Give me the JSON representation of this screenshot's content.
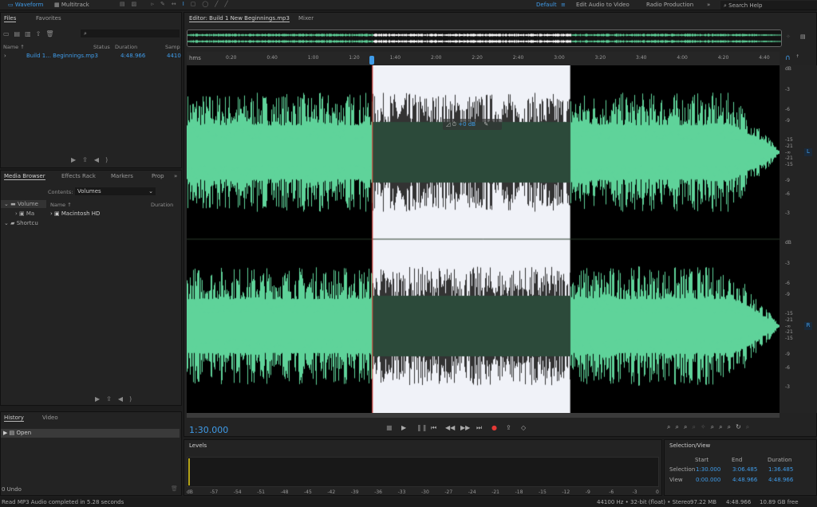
{
  "topbar": {
    "modes": [
      "Waveform",
      "Multitrack"
    ],
    "workspaces": [
      "Default",
      "Edit Audio to Video",
      "Radio Production"
    ],
    "more": "»",
    "search_placeholder": "Search Help"
  },
  "files": {
    "tabs": [
      "Files",
      "Favorites"
    ],
    "columns": [
      "Name ↑",
      "Status",
      "Duration",
      "Samp"
    ],
    "rows": [
      {
        "name": "Build 1... Beginnings.mp3",
        "duration": "4:48.966",
        "sample": "4410"
      }
    ]
  },
  "media_browser": {
    "tabs": [
      "Media Browser",
      "Effects Rack",
      "Markers",
      "Prop"
    ],
    "contents_label": "Contents:",
    "contents_value": "Volumes",
    "tree": [
      "Volume",
      "Ma",
      "Shortcu"
    ],
    "columns": [
      "Name ↑",
      "Duration"
    ],
    "rows": [
      "Macintosh HD"
    ]
  },
  "history": {
    "tabs": [
      "History",
      "Video"
    ],
    "items": [
      "Open"
    ],
    "undo": "0 Undo"
  },
  "status": {
    "message": "Read MP3 Audio completed in 5.28 seconds",
    "format": "44100 Hz • 32-bit (float) • Stereo",
    "size": "97.22 MB",
    "duration": "4:48.966",
    "free": "10.89 GB free"
  },
  "editor": {
    "tabs": [
      "Editor: Build 1 New Beginnings.mp3",
      "Mixer"
    ],
    "ruler_unit": "hms",
    "ruler_ticks": [
      "0:20",
      "0:40",
      "1:00",
      "1:20",
      "1:40",
      "2:00",
      "2:20",
      "2:40",
      "3:00",
      "3:20",
      "3:40",
      "4:00",
      "4:20",
      "4:40"
    ],
    "db_scale": [
      "dB",
      "-3",
      "-6",
      "-9",
      "-15",
      "-21",
      "-∞",
      "-21",
      "-15",
      "-9",
      "-6",
      "-3"
    ],
    "channels": [
      "L",
      "R"
    ],
    "hud_gain": "+0 dB",
    "current_time": "1:30.000",
    "selection_start_s": 90,
    "selection_end_s": 186.485,
    "total_s": 288.966,
    "wave_color": "#5fd39a"
  },
  "levels": {
    "title": "Levels",
    "scale": [
      "dB",
      "-57",
      "-54",
      "-51",
      "-48",
      "-45",
      "-42",
      "-39",
      "-36",
      "-33",
      "-30",
      "-27",
      "-24",
      "-21",
      "-18",
      "-15",
      "-12",
      "-9",
      "-6",
      "-3",
      "0"
    ]
  },
  "selection_view": {
    "title": "Selection/View",
    "columns": [
      "Start",
      "End",
      "Duration"
    ],
    "rows": [
      {
        "label": "Selection",
        "start": "1:30.000",
        "end": "3:06.485",
        "duration": "1:36.485"
      },
      {
        "label": "View",
        "start": "0:00.000",
        "end": "4:48.966",
        "duration": "4:48.966"
      }
    ]
  }
}
